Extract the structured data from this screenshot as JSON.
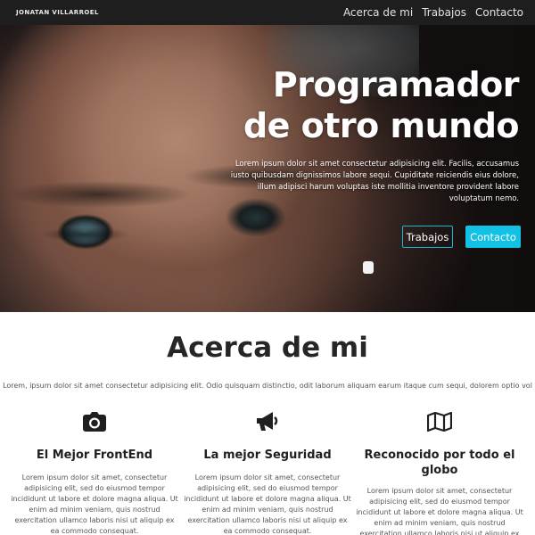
{
  "nav": {
    "brand": "JONATAN VILLARROEL",
    "links": [
      "Acerca de mi",
      "Trabajos",
      "Contacto"
    ]
  },
  "hero": {
    "title_line1": "Programador",
    "title_line2": "de otro mundo",
    "description": "Lorem ipsum dolor sit amet consectetur adipisicing elit. Facilis, accusamus iusto quibusdam dignissimos labore sequi. Cupiditate reiciendis eius dolore, illum adipisci harum voluptas iste mollitia inventore provident labore voluptatum nemo.",
    "buttons": [
      "Trabajos",
      "Contacto"
    ]
  },
  "about": {
    "title": "Acerca de mi",
    "subtitle": "Lorem, ipsum dolor sit amet consectetur adipisicing elit. Odio quisquam distinctio, odit laborum aliquam earum itaque cum sequi, dolorem optio vol",
    "features": [
      {
        "icon": "camera-icon",
        "title": "El Mejor FrontEnd",
        "text": "Lorem ipsum dolor sit amet, consectetur adipisicing elit, sed do eiusmod tempor incididunt ut labore et dolore magna aliqua. Ut enim ad minim veniam, quis nostrud exercitation ullamco laboris nisi ut aliquip ex ea commodo consequat."
      },
      {
        "icon": "megaphone-icon",
        "title": "La mejor Seguridad",
        "text": "Lorem ipsum dolor sit amet, consectetur adipisicing elit, sed do eiusmod tempor incididunt ut labore et dolore magna aliqua. Ut enim ad minim veniam, quis nostrud exercitation ullamco laboris nisi ut aliquip ex ea commodo consequat."
      },
      {
        "icon": "map-icon",
        "title": "Reconocido por todo el globo",
        "text": "Lorem ipsum dolor sit amet, consectetur adipisicing elit, sed do eiusmod tempor incididunt ut labore et dolore magna aliqua. Ut enim ad minim veniam, quis nostrud exercitation ullamco laboris nisi ut aliquip ex ea commodo consequat."
      }
    ]
  },
  "colors": {
    "nav_bg": "#1e1e1e",
    "accent": "#13c1e4",
    "heading": "#262626"
  }
}
